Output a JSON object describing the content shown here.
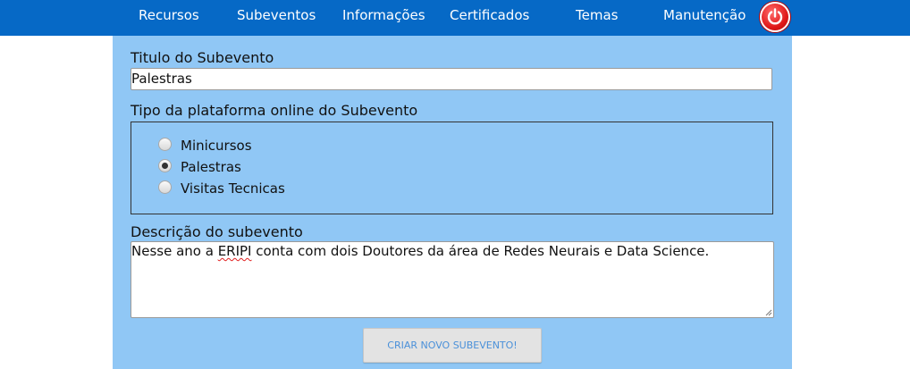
{
  "nav": {
    "items": [
      {
        "label": "Recursos"
      },
      {
        "label": "Subeventos"
      },
      {
        "label": "Informações"
      },
      {
        "label": "Certificados"
      },
      {
        "label": "Temas"
      },
      {
        "label": "Manutenção"
      }
    ],
    "power_icon": "power-icon"
  },
  "form": {
    "title_label": "Titulo do Subevento",
    "title_value": "Palestras",
    "platform_label": "Tipo da plataforma online do Subevento",
    "platform_options": [
      {
        "label": "Minicursos",
        "checked": false
      },
      {
        "label": "Palestras",
        "checked": true
      },
      {
        "label": "Visitas Tecnicas",
        "checked": false
      }
    ],
    "description_label": "Descrição do subevento",
    "description_before": "Nesse ano a ",
    "description_flagged": "ERIPI",
    "description_after": " conta com dois Doutores da área de Redes Neurais e Data Science.",
    "submit_label": "CRIAR NOVO SUBEVENTO!"
  },
  "colors": {
    "topbar": "#0669c6",
    "panel": "#90c7f5",
    "power_button": "#e01a1a",
    "submit_text": "#4a90d9"
  }
}
